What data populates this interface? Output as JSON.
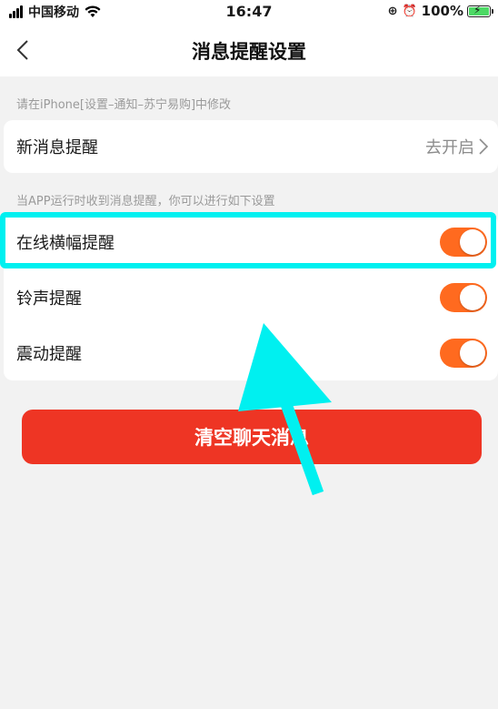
{
  "status_bar": {
    "carrier": "中国移动",
    "time": "16:47",
    "battery": "100%"
  },
  "nav": {
    "title": "消息提醒设置"
  },
  "section1": {
    "hint": "请在iPhone[设置–通知–苏宁易购]中修改",
    "row": {
      "label": "新消息提醒",
      "value": "去开启"
    }
  },
  "section2": {
    "hint": "当APP运行时收到消息提醒，你可以进行如下设置",
    "rows": [
      {
        "label": "在线横幅提醒",
        "enabled": true
      },
      {
        "label": "铃声提醒",
        "enabled": true
      },
      {
        "label": "震动提醒",
        "enabled": true
      }
    ]
  },
  "actions": {
    "clear_label": "清空聊天消息"
  },
  "colors": {
    "accent": "#ff6a1f",
    "button": "#ee3524",
    "highlight": "#00f0f0"
  }
}
